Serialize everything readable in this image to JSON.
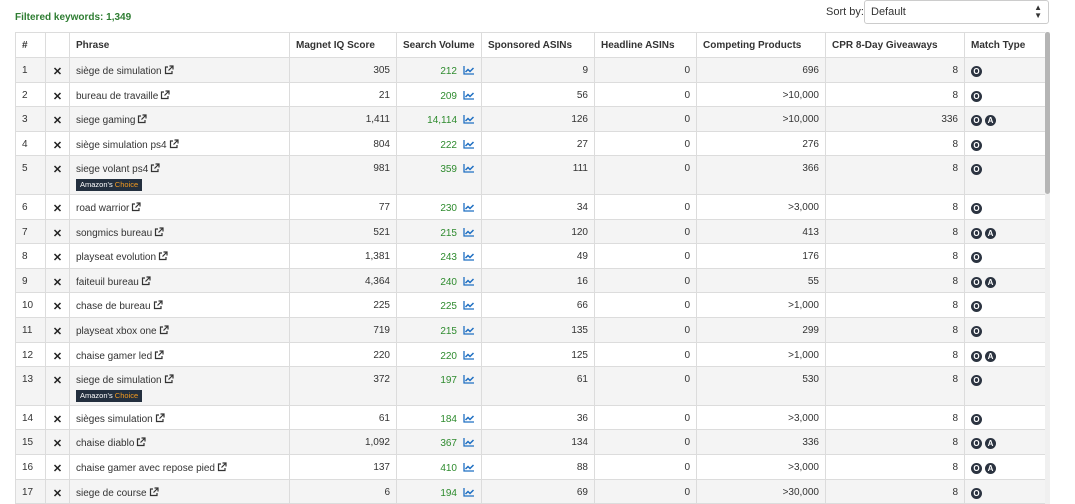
{
  "header": {
    "filtered": "Filtered keywords: 1,349",
    "sort_label": "Sort by:",
    "sort_value": "Default"
  },
  "columns": [
    "#",
    "",
    "Phrase",
    "Magnet IQ Score",
    "Search Volume",
    "Sponsored ASINs",
    "Headline ASINs",
    "Competing Products",
    "CPR 8-Day Giveaways",
    "Match Type"
  ],
  "amazons_choice": {
    "prefix": "Amazon's",
    "suffix": "Choice"
  },
  "colors": {
    "green": "#2e8b2e",
    "trend_blue": "#1f6fc2",
    "badge": "#2b3340"
  },
  "rows": [
    {
      "n": "1",
      "phrase": "siège de simulation",
      "score": "305",
      "volume": "212",
      "sponsored": "9",
      "headline": "0",
      "competing": "696",
      "cpr": "8",
      "match": [
        "O"
      ],
      "choice": false
    },
    {
      "n": "2",
      "phrase": "bureau de travaille",
      "score": "21",
      "volume": "209",
      "sponsored": "56",
      "headline": "0",
      "competing": ">10,000",
      "cpr": "8",
      "match": [
        "O"
      ],
      "choice": false
    },
    {
      "n": "3",
      "phrase": "siege gaming",
      "score": "1,411",
      "volume": "14,114",
      "sponsored": "126",
      "headline": "0",
      "competing": ">10,000",
      "cpr": "336",
      "match": [
        "O",
        "A"
      ],
      "choice": false
    },
    {
      "n": "4",
      "phrase": "siège simulation ps4",
      "score": "804",
      "volume": "222",
      "sponsored": "27",
      "headline": "0",
      "competing": "276",
      "cpr": "8",
      "match": [
        "O"
      ],
      "choice": false
    },
    {
      "n": "5",
      "phrase": "siege volant ps4",
      "score": "981",
      "volume": "359",
      "sponsored": "111",
      "headline": "0",
      "competing": "366",
      "cpr": "8",
      "match": [
        "O"
      ],
      "choice": true
    },
    {
      "n": "6",
      "phrase": "road warrior",
      "score": "77",
      "volume": "230",
      "sponsored": "34",
      "headline": "0",
      "competing": ">3,000",
      "cpr": "8",
      "match": [
        "O"
      ],
      "choice": false
    },
    {
      "n": "7",
      "phrase": "songmics bureau",
      "score": "521",
      "volume": "215",
      "sponsored": "120",
      "headline": "0",
      "competing": "413",
      "cpr": "8",
      "match": [
        "O",
        "A"
      ],
      "choice": false
    },
    {
      "n": "8",
      "phrase": "playseat evolution",
      "score": "1,381",
      "volume": "243",
      "sponsored": "49",
      "headline": "0",
      "competing": "176",
      "cpr": "8",
      "match": [
        "O"
      ],
      "choice": false
    },
    {
      "n": "9",
      "phrase": "faiteuil bureau",
      "score": "4,364",
      "volume": "240",
      "sponsored": "16",
      "headline": "0",
      "competing": "55",
      "cpr": "8",
      "match": [
        "O",
        "A"
      ],
      "choice": false
    },
    {
      "n": "10",
      "phrase": "chase de bureau",
      "score": "225",
      "volume": "225",
      "sponsored": "66",
      "headline": "0",
      "competing": ">1,000",
      "cpr": "8",
      "match": [
        "O"
      ],
      "choice": false
    },
    {
      "n": "11",
      "phrase": "playseat xbox one",
      "score": "719",
      "volume": "215",
      "sponsored": "135",
      "headline": "0",
      "competing": "299",
      "cpr": "8",
      "match": [
        "O"
      ],
      "choice": false
    },
    {
      "n": "12",
      "phrase": "chaise gamer led",
      "score": "220",
      "volume": "220",
      "sponsored": "125",
      "headline": "0",
      "competing": ">1,000",
      "cpr": "8",
      "match": [
        "O",
        "A"
      ],
      "choice": false
    },
    {
      "n": "13",
      "phrase": "siege de simulation",
      "score": "372",
      "volume": "197",
      "sponsored": "61",
      "headline": "0",
      "competing": "530",
      "cpr": "8",
      "match": [
        "O"
      ],
      "choice": true
    },
    {
      "n": "14",
      "phrase": "sièges simulation",
      "score": "61",
      "volume": "184",
      "sponsored": "36",
      "headline": "0",
      "competing": ">3,000",
      "cpr": "8",
      "match": [
        "O"
      ],
      "choice": false
    },
    {
      "n": "15",
      "phrase": "chaise diablo",
      "score": "1,092",
      "volume": "367",
      "sponsored": "134",
      "headline": "0",
      "competing": "336",
      "cpr": "8",
      "match": [
        "O",
        "A"
      ],
      "choice": false
    },
    {
      "n": "16",
      "phrase": "chaise gamer avec repose pied",
      "score": "137",
      "volume": "410",
      "sponsored": "88",
      "headline": "0",
      "competing": ">3,000",
      "cpr": "8",
      "match": [
        "O",
        "A"
      ],
      "choice": false
    },
    {
      "n": "17",
      "phrase": "siege de course",
      "score": "6",
      "volume": "194",
      "sponsored": "69",
      "headline": "0",
      "competing": ">30,000",
      "cpr": "8",
      "match": [
        "O"
      ],
      "choice": false
    }
  ]
}
